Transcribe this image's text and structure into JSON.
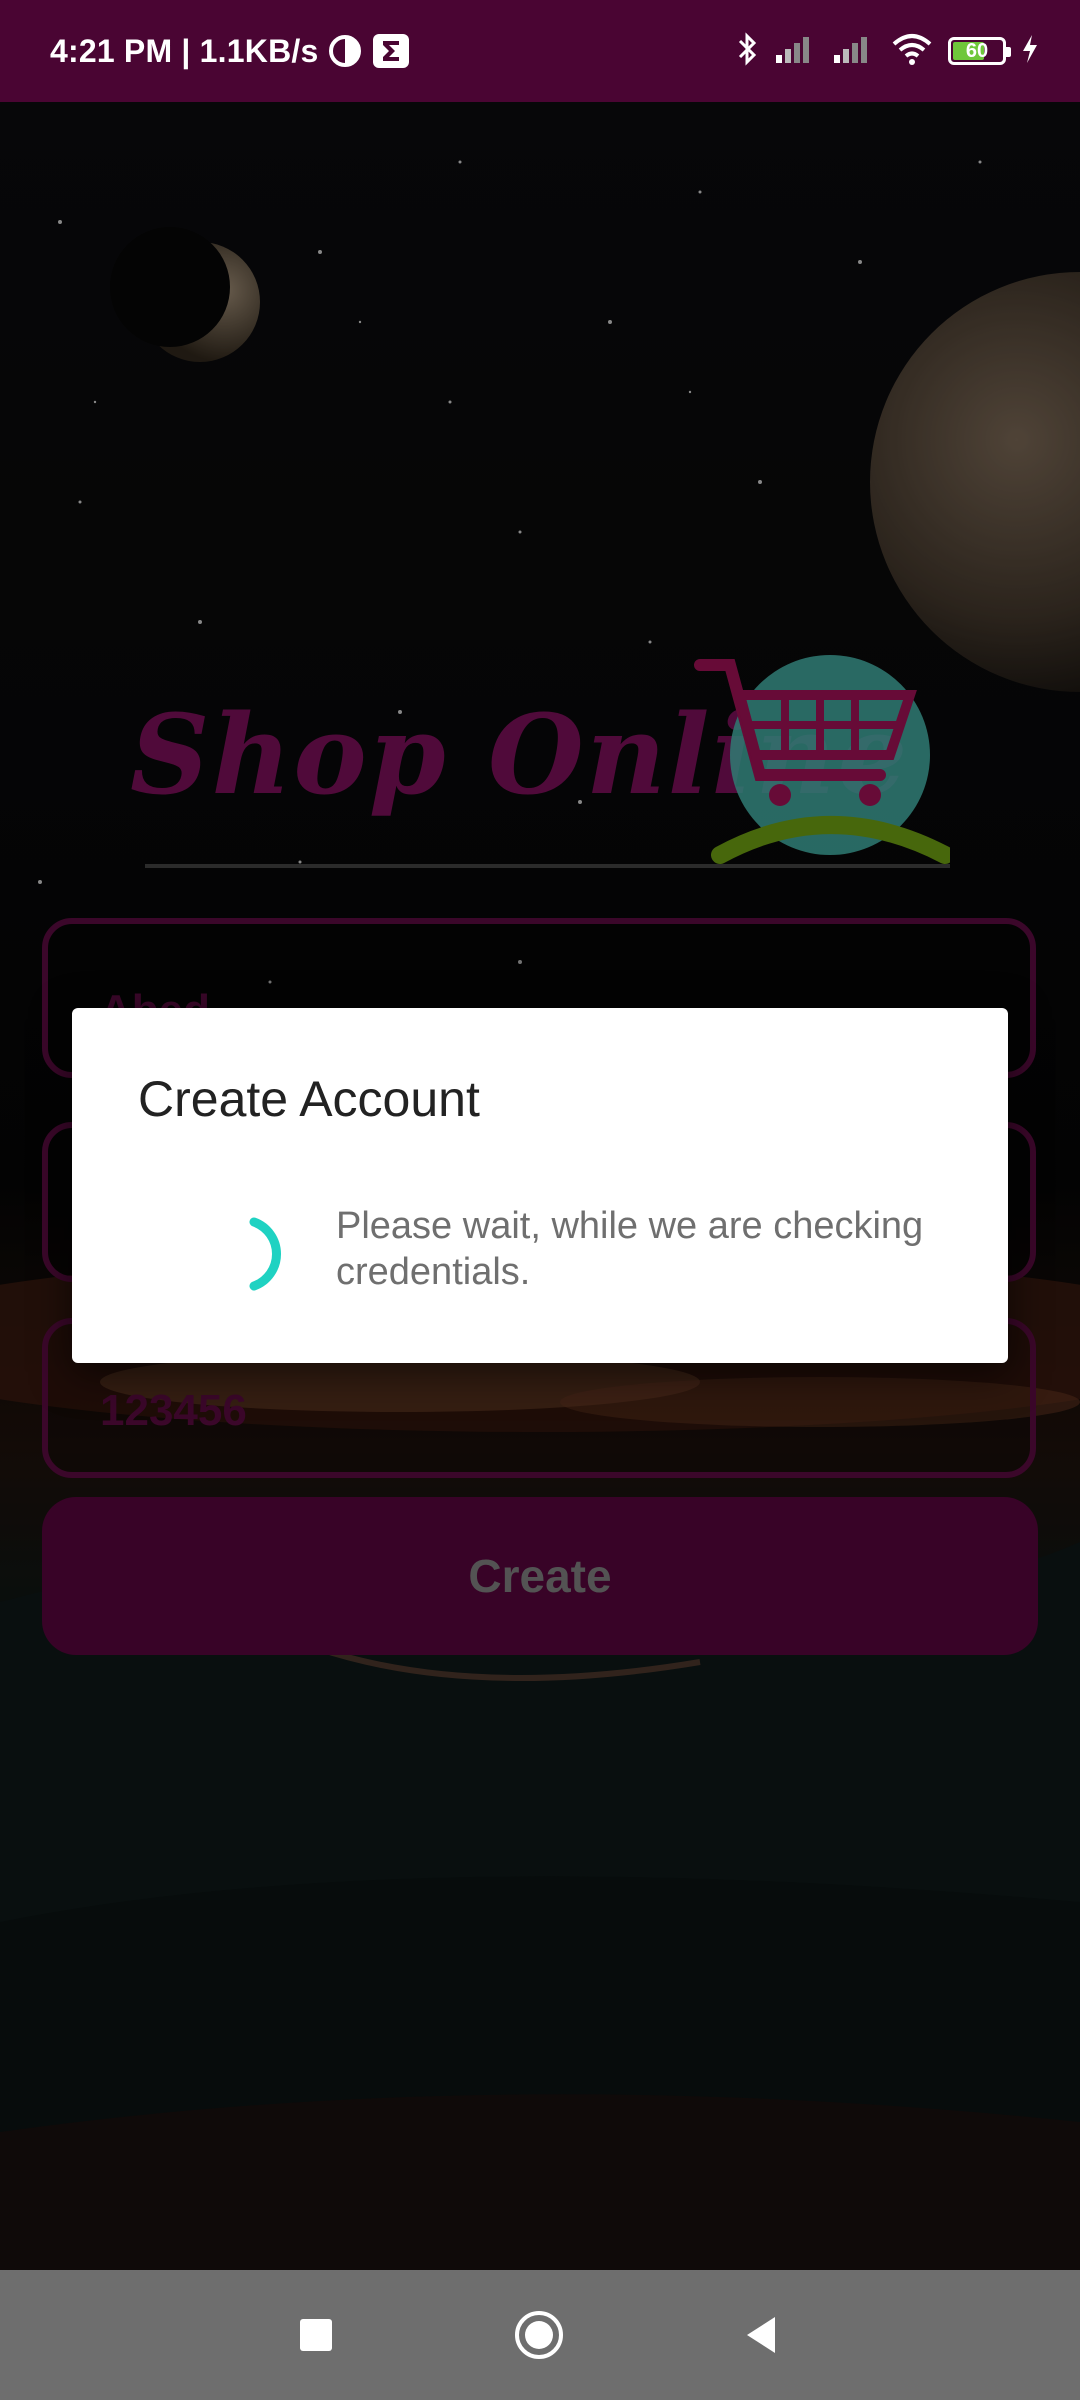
{
  "status_bar": {
    "time_speed": "4:21 PM | 1.1KB/s",
    "battery_level": "60",
    "icons": [
      "data-saver-icon",
      "sigma-icon",
      "bluetooth-icon",
      "signal-icon",
      "signal-icon",
      "wifi-icon",
      "battery-icon",
      "charging-icon"
    ]
  },
  "app": {
    "logo_text": "Shop Online",
    "logo_icon": "shopping-cart-icon",
    "fields": [
      {
        "value": "Abed"
      },
      {
        "value": ""
      },
      {
        "value": "123456"
      }
    ],
    "create_button": "Create"
  },
  "dialog": {
    "title": "Create Account",
    "message": "Please wait, while we are checking credentials."
  },
  "colors": {
    "status_bar": "#4a0533",
    "accent": "#4b0434",
    "spinner": "#1fd2c2"
  },
  "nav_bar": {
    "icons": [
      "recents-square-icon",
      "home-circle-icon",
      "back-triangle-icon"
    ]
  }
}
